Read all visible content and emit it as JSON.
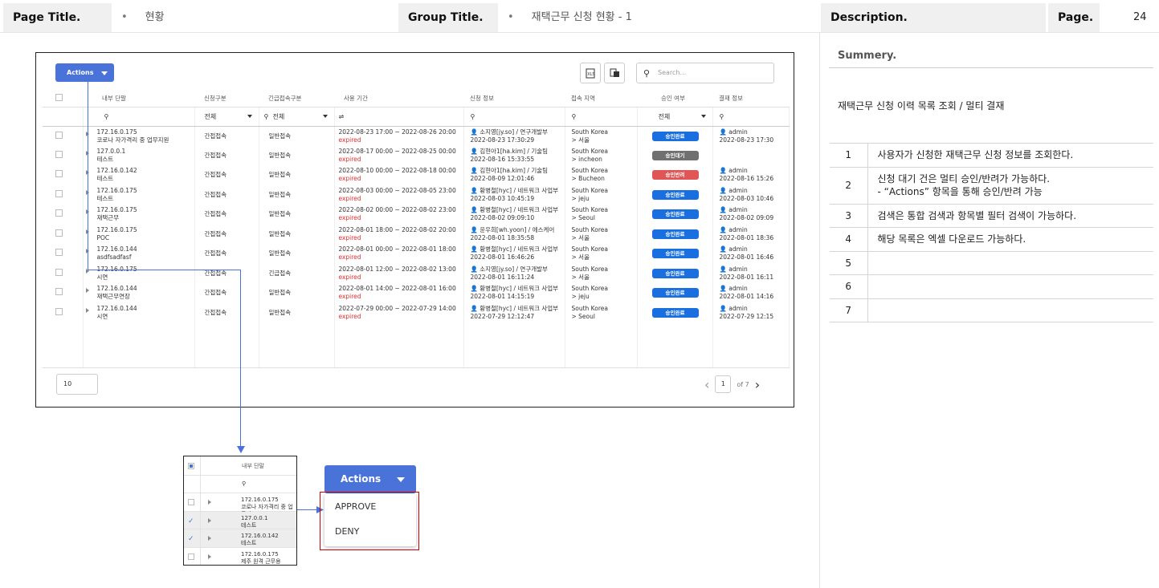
{
  "header": {
    "page_title_label": "Page Title.",
    "page_title_value": "현황",
    "group_title_label": "Group Title.",
    "group_title_value": "재택근무 신청 현황 - 1",
    "description_label": "Description.",
    "page_label": "Page.",
    "page_number": "24",
    "bullet": "•"
  },
  "toolbar": {
    "actions_label": "Actions",
    "search_placeholder": "Search...",
    "icons": [
      "excel-icon",
      "copy-icon"
    ]
  },
  "table": {
    "columns": [
      "내부 단말",
      "신청구분",
      "긴급접속구분",
      "사용 기간",
      "신청 정보",
      "접속 지역",
      "승인 여부",
      "결재 정보"
    ],
    "filters": {
      "apply_type": "전체",
      "emergency": "전체",
      "approval": "전체",
      "period_icon": "⇌"
    },
    "expired_text": "expired",
    "rows": [
      {
        "ip": "172.16.0.175",
        "name": "코로나 자가격리 중 업무지원",
        "apply": "간접접속",
        "emergency": "일반접속",
        "period": "2022-08-23 17:00 ~ 2022-08-26 20:00",
        "user": "소지영[jy.so] / 연구개발부",
        "req_time": "2022-08-23 17:30:29",
        "country": "South Korea",
        "city": "> 서울",
        "status": "승인완료",
        "status_color": "#1a6fe0",
        "approver": "admin",
        "appr_time": "2022-08-23 17:30"
      },
      {
        "ip": "127.0.0.1",
        "name": "테스트",
        "apply": "간접접속",
        "emergency": "일반접속",
        "period": "2022-08-17 00:00 ~ 2022-08-25 00:00",
        "user": "김현아1[ha.kim] / 기술팀",
        "req_time": "2022-08-16 15:33:55",
        "country": "South Korea",
        "city": "> incheon",
        "status": "승인대기",
        "status_color": "#707070",
        "approver": "",
        "appr_time": ""
      },
      {
        "ip": "172.16.0.142",
        "name": "테스트",
        "apply": "간접접속",
        "emergency": "일반접속",
        "period": "2022-08-10 00:00 ~ 2022-08-18 00:00",
        "user": "김현아1[ha.kim] / 기술팀",
        "req_time": "2022-08-09 12:01:46",
        "country": "South Korea",
        "city": "> Bucheon",
        "status": "승인반려",
        "status_color": "#e05555",
        "approver": "admin",
        "appr_time": "2022-08-16 15:26"
      },
      {
        "ip": "172.16.0.175",
        "name": "테스트",
        "apply": "간접접속",
        "emergency": "일반접속",
        "period": "2022-08-03 00:00 ~ 2022-08-05 23:00",
        "user": "황병철[hyc] / 네트워크 사업부",
        "req_time": "2022-08-03 10:45:19",
        "country": "South Korea",
        "city": "> jeju",
        "status": "승인완료",
        "status_color": "#1a6fe0",
        "approver": "admin",
        "appr_time": "2022-08-03 10:46"
      },
      {
        "ip": "172.16.0.175",
        "name": "재택근무",
        "apply": "간접접속",
        "emergency": "일반접속",
        "period": "2022-08-02 00:00 ~ 2022-08-02 23:00",
        "user": "황병철[hyc] / 네트워크 사업부",
        "req_time": "2022-08-02 09:09:10",
        "country": "South Korea",
        "city": "> Seoul",
        "status": "승인완료",
        "status_color": "#1a6fe0",
        "approver": "admin",
        "appr_time": "2022-08-02 09:09"
      },
      {
        "ip": "172.16.0.175",
        "name": "POC",
        "apply": "간접접속",
        "emergency": "일반접속",
        "period": "2022-08-01 18:00 ~ 2022-08-02 20:00",
        "user": "윤우희[wh.yoon] / 에스케어",
        "req_time": "2022-08-01 18:35:58",
        "country": "South Korea",
        "city": "> 서울",
        "status": "승인완료",
        "status_color": "#1a6fe0",
        "approver": "admin",
        "appr_time": "2022-08-01 18:36"
      },
      {
        "ip": "172.16.0.144",
        "name": "asdfsadfasf",
        "apply": "간접접속",
        "emergency": "일반접속",
        "period": "2022-08-01 00:00 ~ 2022-08-01 18:00",
        "user": "황병철[hyc] / 네트워크 사업부",
        "req_time": "2022-08-01 16:46:26",
        "country": "South Korea",
        "city": "> 서울",
        "status": "승인완료",
        "status_color": "#1a6fe0",
        "approver": "admin",
        "appr_time": "2022-08-01 16:46"
      },
      {
        "ip": "172.16.0.175",
        "name": "시연",
        "apply": "간접접속",
        "emergency": "긴급접속",
        "period": "2022-08-01 12:00 ~ 2022-08-02 13:00",
        "user": "소지영[jy.so] / 연구개발부",
        "req_time": "2022-08-01 16:11:24",
        "country": "South Korea",
        "city": "> 서울",
        "status": "승인완료",
        "status_color": "#1a6fe0",
        "approver": "admin",
        "appr_time": "2022-08-01 16:11"
      },
      {
        "ip": "172.16.0.144",
        "name": "재택근무연장",
        "apply": "간접접속",
        "emergency": "일반접속",
        "period": "2022-08-01 14:00 ~ 2022-08-01 16:00",
        "user": "황병철[hyc] / 네트워크 사업부",
        "req_time": "2022-08-01 14:15:19",
        "country": "South Korea",
        "city": "> jeju",
        "status": "승인완료",
        "status_color": "#1a6fe0",
        "approver": "admin",
        "appr_time": "2022-08-01 14:16"
      },
      {
        "ip": "172.16.0.144",
        "name": "시연",
        "apply": "간접접속",
        "emergency": "일반접속",
        "period": "2022-07-29 00:00 ~ 2022-07-29 14:00",
        "user": "황병철[hyc] / 네트워크 사업부",
        "req_time": "2022-07-29 12:12:47",
        "country": "South Korea",
        "city": "> Seoul",
        "status": "승인완료",
        "status_color": "#1a6fe0",
        "approver": "admin",
        "appr_time": "2022-07-29 12:15"
      }
    ]
  },
  "pagination": {
    "page_size": "10",
    "current_page": "1",
    "of_label": "of 7"
  },
  "zoom": {
    "header": "내부 단말",
    "rows": [
      {
        "ip": "172.16.0.175",
        "name": "코로나 자가격리 중 업무지",
        "checked": false
      },
      {
        "ip": "127.0.0.1",
        "name": "테스트",
        "checked": true
      },
      {
        "ip": "172.16.0.142",
        "name": "테스트",
        "checked": true
      },
      {
        "ip": "172.16.0.175",
        "name": "제주 원격 근무용",
        "checked": false
      }
    ]
  },
  "actions_menu": {
    "label": "Actions",
    "items": [
      "APPROVE",
      "DENY"
    ]
  },
  "panel": {
    "summary_label": "Summery.",
    "summary_text": "재택근무 신청 이력 목록 조회 / 멀티 결재",
    "items": [
      {
        "n": "1",
        "text": "사용자가 신청한 재택근무 신청 정보를 조회한다.",
        "text2": ""
      },
      {
        "n": "2",
        "text": "신청 대기 건은 멀티 승인/반려가 가능하다.",
        "text2": " - “Actions” 항목을 통해 승인/반려 가능"
      },
      {
        "n": "3",
        "text": "검색은 통합 검색과 항목별 필터 검색이 가능하다.",
        "text2": ""
      },
      {
        "n": "4",
        "text": "해당 목록은 엑셀 다운로드 가능하다.",
        "text2": ""
      },
      {
        "n": "5",
        "text": "",
        "text2": ""
      },
      {
        "n": "6",
        "text": "",
        "text2": ""
      },
      {
        "n": "7",
        "text": "",
        "text2": ""
      }
    ]
  }
}
